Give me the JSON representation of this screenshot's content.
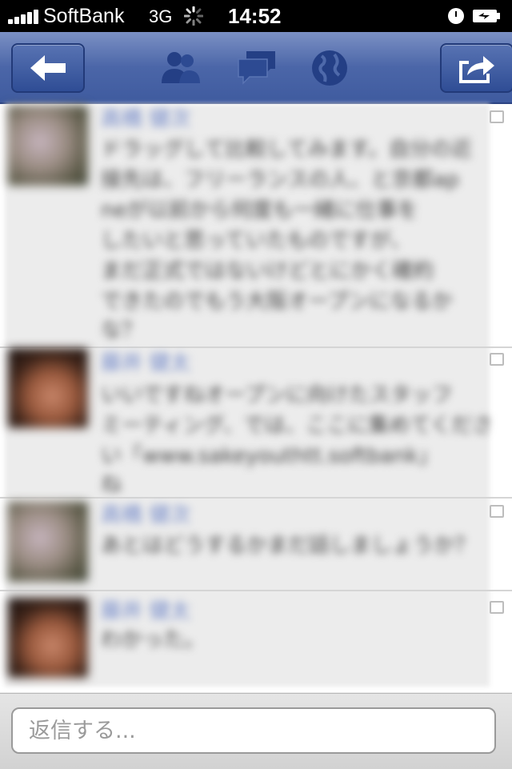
{
  "status_bar": {
    "carrier": "SoftBank",
    "network": "3G",
    "time": "14:52"
  },
  "nav": {
    "icons": [
      "back-arrow-icon",
      "friends-icon",
      "messages-icon",
      "globe-icon",
      "share-icon"
    ]
  },
  "comments": [
    {
      "avatar": "avatar-a",
      "name": "高橋 健次",
      "lines": [
        "ドラッグして比較してみます。自分の近",
        "接先は、フリーランスの人、と京都ap",
        "neが以前から何度も一緒に仕事を",
        "したいと思っていたものですが、",
        "まだ正式ではないけどとにかく確約",
        "できたのでもう大阪オープンになるか",
        "な？"
      ]
    },
    {
      "avatar": "avatar-b",
      "name": "藤井 健太",
      "lines": [
        "いいですねオープンに向けたスタッフ",
        "ミーティング、では、ここに集めてくださ",
        "い「www.sakeyouthtt.softbank」",
        "ね"
      ]
    },
    {
      "avatar": "avatar-a",
      "name": "高橋 健次",
      "lines": [
        "あとはどうするかまだ話しましょうか？"
      ]
    },
    {
      "avatar": "avatar-b",
      "name": "藤井 健太",
      "lines": [
        "わかった。"
      ]
    }
  ],
  "reply": {
    "placeholder": "返信する..."
  }
}
